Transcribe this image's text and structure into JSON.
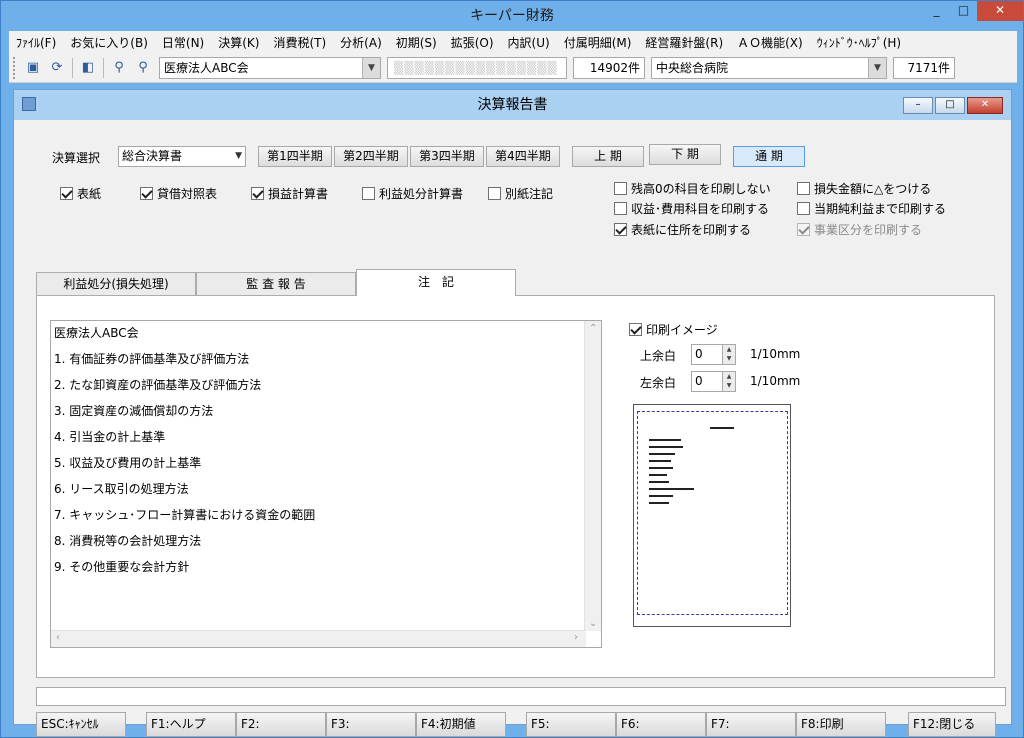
{
  "app": {
    "title": "キーパー財務",
    "window_controls": [
      "_",
      "□",
      "✕"
    ]
  },
  "menu": [
    "ﾌｧｲﾙ(F)",
    "お気に入り(B)",
    "日常(N)",
    "決算(K)",
    "消費税(T)",
    "分析(A)",
    "初期(S)",
    "拡張(O)",
    "内訳(U)",
    "付属明細(M)",
    "経営羅針盤(R)",
    "ＡＯ機能(X)",
    "ｳｨﾝﾄﾞｳ･ﾍﾙﾌﾟ(H)"
  ],
  "toolbar": {
    "company": "医療法人ABC会",
    "masked": "▒▒▒▒▒▒▒▒▒▒▒▒▒▒▒▒",
    "count1": "14902件",
    "hospital": "中央総合病院",
    "count2": "7171件"
  },
  "dialog": {
    "title": "決算報告書",
    "controls": [
      "–",
      "□",
      "✕"
    ],
    "selection_label": "決算選択",
    "selection_value": "総合決算書",
    "quarters": [
      "第1四半期",
      "第2四半期",
      "第3四半期",
      "第4四半期"
    ],
    "periods": [
      "上 期",
      "下 期",
      "通 期"
    ],
    "active_period": "通 期",
    "checks_left": [
      {
        "label": "表紙",
        "checked": true
      },
      {
        "label": "貸借対照表",
        "checked": true
      },
      {
        "label": "損益計算書",
        "checked": true
      },
      {
        "label": "利益処分計算書",
        "checked": false
      },
      {
        "label": "別紙注記",
        "checked": false
      }
    ],
    "checks_right": [
      {
        "label": "残高0の科目を印刷しない",
        "checked": false
      },
      {
        "label": "収益･費用科目を印刷する",
        "checked": false
      },
      {
        "label": "表紙に住所を印刷する",
        "checked": true
      },
      {
        "label": "損失金額に△をつける",
        "checked": false
      },
      {
        "label": "当期純利益まで印刷する",
        "checked": false
      },
      {
        "label": "事業区分を印刷する",
        "checked": true,
        "disabled": true
      }
    ],
    "tabs": [
      "利益処分(損失処理)",
      "監 査 報 告",
      "注　記"
    ],
    "notes": [
      "医療法人ABC会",
      "1. 有価証券の評価基準及び評価方法",
      "2. たな卸資産の評価基準及び評価方法",
      "3. 固定資産の減価償却の方法",
      "4. 引当金の計上基準",
      "5. 収益及び費用の計上基準",
      "6. リース取引の処理方法",
      "7. キャッシュ･フロー計算書における資金の範囲",
      "8. 消費税等の会計処理方法",
      "9. その他重要な会計方針"
    ],
    "print_image": {
      "label": "印刷イメージ",
      "checked": true
    },
    "top_margin": {
      "label": "上余白",
      "value": "0",
      "unit": "1/10mm"
    },
    "left_margin": {
      "label": "左余白",
      "value": "0",
      "unit": "1/10mm"
    }
  },
  "fkeys": [
    "ESC:ｷｬﾝｾﾙ",
    "F1:ヘルプ",
    "F2:",
    "F3:",
    "F4:初期値",
    "F5:",
    "F6:",
    "F7:",
    "F8:印刷",
    "F12:閉じる"
  ],
  "colors": {
    "title_bg": "#6fb0ea",
    "child_title_bg": "#aad0f2",
    "active_button": "#d8eaf9",
    "close_red": "#c74a3b"
  }
}
